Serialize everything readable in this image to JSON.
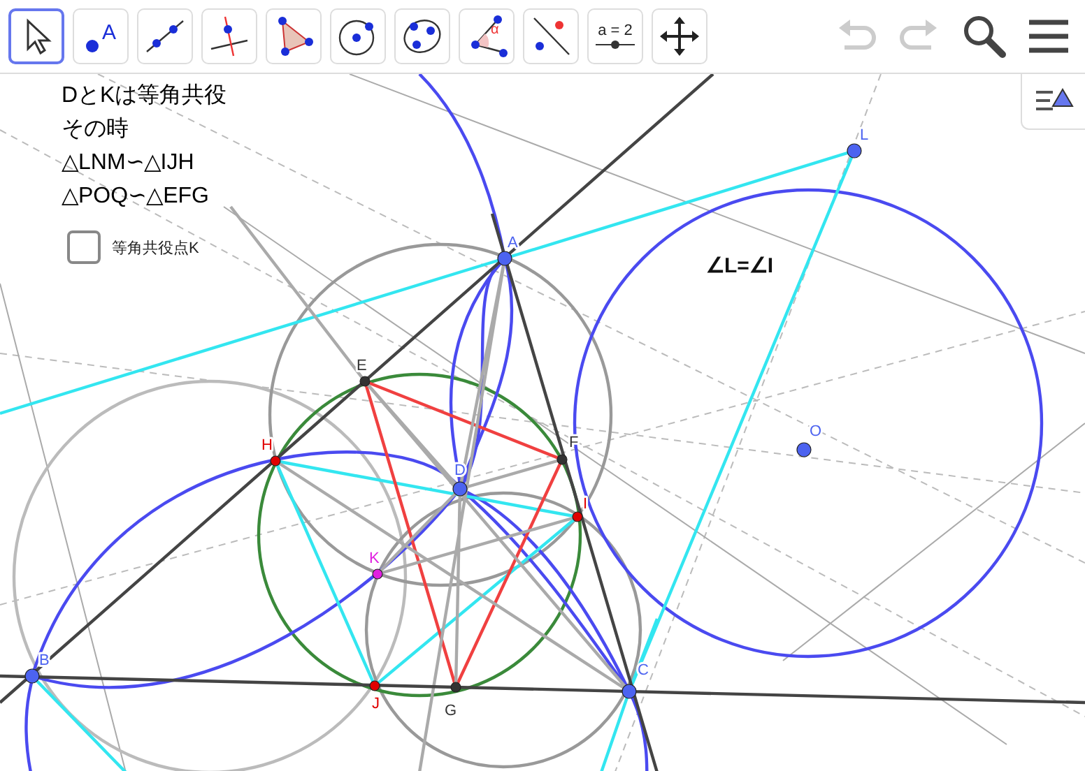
{
  "toolbar": {
    "tools": [
      {
        "kind": "move",
        "selected": true
      },
      {
        "kind": "point",
        "selected": false,
        "text": "A"
      },
      {
        "kind": "line",
        "selected": false
      },
      {
        "kind": "perpendicular",
        "selected": false
      },
      {
        "kind": "polygon",
        "selected": false
      },
      {
        "kind": "circle",
        "selected": false
      },
      {
        "kind": "conic",
        "selected": false
      },
      {
        "kind": "angle",
        "selected": false,
        "text": "α"
      },
      {
        "kind": "reflect",
        "selected": false
      },
      {
        "kind": "slider",
        "selected": false,
        "text": "a = 2"
      },
      {
        "kind": "pan",
        "selected": false
      }
    ],
    "undo": {
      "disabled": true
    },
    "redo": {
      "disabled": true
    }
  },
  "notes": [
    "DとKは等角共役",
    "その時",
    "△LNM∽△IJH",
    "△POQ∽△EFG"
  ],
  "checkbox": {
    "label": "等角共役点K",
    "checked": false
  },
  "angle_text": "∠L=∠I",
  "points": [
    {
      "label": "A",
      "color": "#4c63f0"
    },
    {
      "label": "B",
      "color": "#4c63f0"
    },
    {
      "label": "C",
      "color": "#4c63f0"
    },
    {
      "label": "D",
      "color": "#4c63f0"
    },
    {
      "label": "E",
      "color": "#333333"
    },
    {
      "label": "F",
      "color": "#333333"
    },
    {
      "label": "G",
      "color": "#333333"
    },
    {
      "label": "H",
      "color": "#e00000"
    },
    {
      "label": "I",
      "color": "#e00000"
    },
    {
      "label": "J",
      "color": "#e00000"
    },
    {
      "label": "K",
      "color": "#e020e0"
    },
    {
      "label": "L",
      "color": "#4c63f0"
    },
    {
      "label": "O",
      "color": "#4c63f0"
    }
  ]
}
